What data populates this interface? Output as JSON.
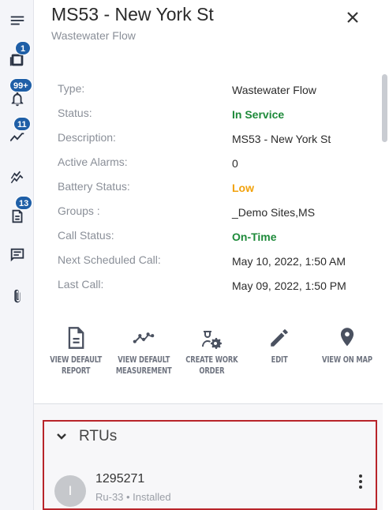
{
  "header": {
    "title": "MS53 - New York St",
    "subtitle": "Wastewater Flow"
  },
  "rail": {
    "items": [
      {
        "icon": "menu-icon",
        "badge": ""
      },
      {
        "icon": "layers-icon",
        "badge": "1"
      },
      {
        "icon": "bell-icon",
        "badge": "99+"
      },
      {
        "icon": "trend-line-icon",
        "badge": "11"
      },
      {
        "icon": "chart-icon",
        "badge": ""
      },
      {
        "icon": "document-icon",
        "badge": "13"
      },
      {
        "icon": "message-icon",
        "badge": ""
      },
      {
        "icon": "attachment-icon",
        "badge": ""
      }
    ]
  },
  "details": [
    {
      "label": "Type:",
      "value": "Wastewater Flow",
      "status": ""
    },
    {
      "label": "Status:",
      "value": "In Service",
      "status": "green"
    },
    {
      "label": "Description:",
      "value": "MS53 - New York St",
      "status": ""
    },
    {
      "label": "Active Alarms:",
      "value": "0",
      "status": ""
    },
    {
      "label": "Battery Status:",
      "value": "Low",
      "status": "orange"
    },
    {
      "label": "Groups :",
      "value": "_Demo Sites,MS",
      "status": ""
    },
    {
      "label": "Call Status:",
      "value": "On-Time",
      "status": "green"
    },
    {
      "label": "Next Scheduled Call:",
      "value": "May 10, 2022, 1:50 AM",
      "status": ""
    },
    {
      "label": "Last Call:",
      "value": "May 09, 2022, 1:50 PM",
      "status": ""
    }
  ],
  "actions": [
    {
      "line1": "VIEW DEFAULT",
      "line2": "REPORT"
    },
    {
      "line1": "VIEW DEFAULT",
      "line2": "MEASUREMENT"
    },
    {
      "line1": "CREATE WORK",
      "line2": "ORDER"
    },
    {
      "line1": "EDIT",
      "line2": ""
    },
    {
      "line1": "VIEW ON MAP",
      "line2": ""
    }
  ],
  "rtus": {
    "title": "RTUs",
    "items": [
      {
        "avatar": "I",
        "id": "1295271",
        "model": "Ru-33",
        "state": "Installed",
        "subtitle": "Ru-33 • Installed"
      }
    ]
  },
  "colors": {
    "accent": "#1f5fa7",
    "good": "#1e8a3a",
    "warning": "#f2a20c",
    "highlight_border": "#b8242a"
  }
}
